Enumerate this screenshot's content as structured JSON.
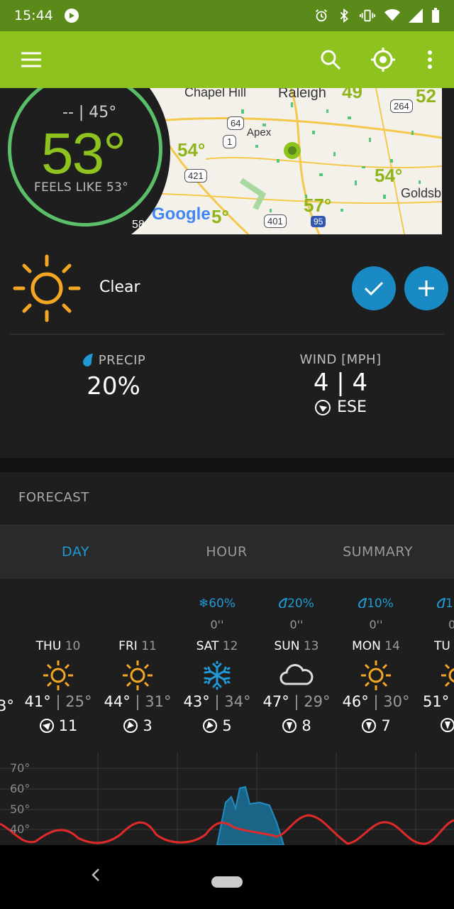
{
  "status_bar": {
    "time": "15:44"
  },
  "toolbar": {
    "menu": "menu-icon",
    "search": "search-icon",
    "locate": "crosshair-icon",
    "more": "more-vert-icon",
    "color": "#8dc21f"
  },
  "current": {
    "hilo": "-- | 45°",
    "temp": "53°",
    "feels_like": "FEELS LIKE 53°",
    "condition": "Clear",
    "precip_label": "PRECIP",
    "precip_value": "20%",
    "wind_label": "WIND [MPH]",
    "wind_value": "4 | 4",
    "wind_dir": "ESE"
  },
  "map": {
    "cities": [
      "Chapel Hill",
      "Raleigh",
      "Apex",
      "Goldsb"
    ],
    "temps": [
      "49",
      "52",
      "54°",
      "54°",
      "57°",
      "58",
      "5°"
    ],
    "shields": [
      "64",
      "264",
      "1",
      "421",
      "401",
      "95"
    ],
    "logo": "Google"
  },
  "forecast": {
    "title": "FORECAST",
    "tabs": [
      "DAY",
      "HOUR",
      "SUMMARY"
    ],
    "active_tab": "DAY",
    "left_partial": "3°",
    "days": [
      {
        "name": "THU",
        "num": "10",
        "precip": "",
        "amount": "",
        "icon": "sun-icon",
        "hi": "41°",
        "lo": "25°",
        "wind": "11"
      },
      {
        "name": "FRI",
        "num": "11",
        "precip": "",
        "amount": "",
        "icon": "sun-icon",
        "hi": "44°",
        "lo": "31°",
        "wind": "3"
      },
      {
        "name": "SAT",
        "num": "12",
        "precip": "❄60%",
        "amount": "0''",
        "icon": "snowflake-icon",
        "hi": "43°",
        "lo": "34°",
        "wind": "5"
      },
      {
        "name": "SUN",
        "num": "13",
        "precip": "20%",
        "amount": "0''",
        "icon": "cloud-icon",
        "hi": "47°",
        "lo": "29°",
        "wind": "8"
      },
      {
        "name": "MON",
        "num": "14",
        "precip": "10%",
        "amount": "0''",
        "icon": "sun-icon",
        "hi": "46°",
        "lo": "30°",
        "wind": "7"
      },
      {
        "name": "TU",
        "num": "",
        "precip": "1",
        "amount": "0",
        "icon": "sun-icon",
        "hi": "51°",
        "lo": "",
        "wind": ""
      }
    ],
    "graph_labels": [
      "70°",
      "60°",
      "50°",
      "40°"
    ]
  }
}
